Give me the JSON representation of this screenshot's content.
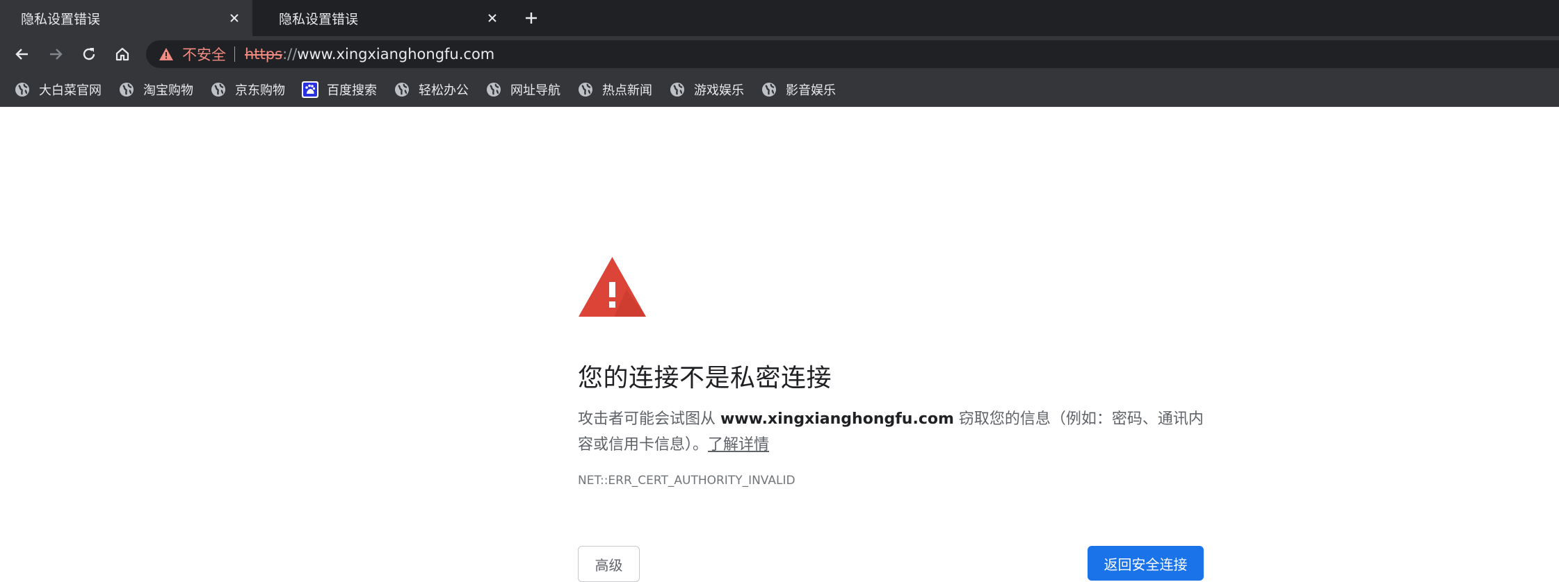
{
  "tabs": [
    {
      "title": "隐私设置错误",
      "active": true
    },
    {
      "title": "隐私设置错误",
      "active": false
    }
  ],
  "new_tab_icon": "plus-icon",
  "toolbar": {
    "insecure_label": "不安全",
    "url_scheme": "https",
    "url_slashes": "://",
    "url_host": "www.xingxianghongfu.com"
  },
  "bookmarks": [
    {
      "label": "大白菜官网",
      "icon": "globe-icon"
    },
    {
      "label": "淘宝购物",
      "icon": "globe-icon"
    },
    {
      "label": "京东购物",
      "icon": "globe-icon"
    },
    {
      "label": "百度搜索",
      "icon": "baidu-icon"
    },
    {
      "label": "轻松办公",
      "icon": "globe-icon"
    },
    {
      "label": "网址导航",
      "icon": "globe-icon"
    },
    {
      "label": "热点新闻",
      "icon": "globe-icon"
    },
    {
      "label": "游戏娱乐",
      "icon": "globe-icon"
    },
    {
      "label": "影音娱乐",
      "icon": "globe-icon"
    }
  ],
  "interstitial": {
    "heading": "您的连接不是私密连接",
    "body_prefix": "攻击者可能会试图从 ",
    "body_domain": "www.xingxianghongfu.com",
    "body_suffix": " 窃取您的信息（例如：密码、通讯内容或信用卡信息）。",
    "learn_more": "了解详情",
    "error_code": "NET::ERR_CERT_AUTHORITY_INVALID",
    "advanced_button": "高级",
    "back_button": "返回安全连接"
  },
  "colors": {
    "warning_red": "#db4437",
    "primary_blue": "#1a73e8",
    "insecure_red": "#f28b82"
  }
}
